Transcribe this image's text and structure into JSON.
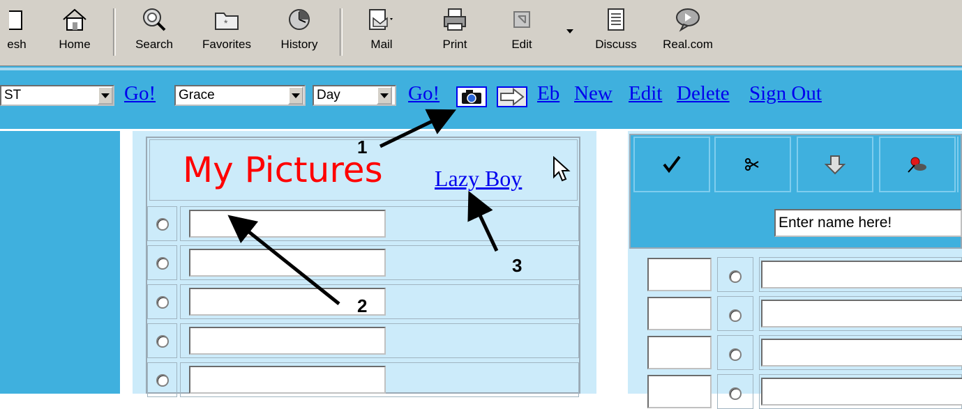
{
  "toolbar": {
    "buttons": [
      {
        "label": "esh",
        "icon": "refresh-icon"
      },
      {
        "label": "Home",
        "icon": "home-icon"
      },
      {
        "label": "Search",
        "icon": "search-icon"
      },
      {
        "label": "Favorites",
        "icon": "favorites-icon"
      },
      {
        "label": "History",
        "icon": "history-icon"
      },
      {
        "label": "Mail",
        "icon": "mail-icon"
      },
      {
        "label": "Print",
        "icon": "print-icon"
      },
      {
        "label": "Edit",
        "icon": "edit-icon"
      },
      {
        "label": "Discuss",
        "icon": "discuss-icon"
      },
      {
        "label": "Real.com",
        "icon": "real-com-icon"
      }
    ]
  },
  "nav": {
    "select1_value": "ST",
    "go1": "Go!",
    "select2_value": "Grace",
    "select3_value": "Day",
    "go2": "Go!",
    "links": [
      "Eb",
      "New",
      "Edit",
      "Delete",
      "Sign Out"
    ]
  },
  "pictures": {
    "title": "My Pictures",
    "link": "Lazy Boy"
  },
  "right": {
    "name_placeholder": "Enter name here!"
  },
  "annotations": [
    "1",
    "2",
    "3"
  ]
}
